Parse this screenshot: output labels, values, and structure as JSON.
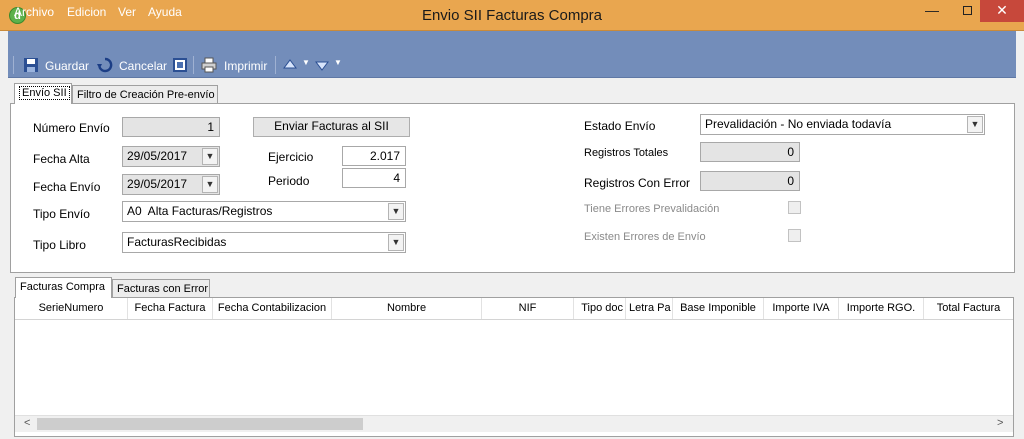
{
  "window": {
    "title": "Envio SII Facturas Compra",
    "app_icon": "d",
    "minimize": "—",
    "close": "✕"
  },
  "menu": [
    "Archivo",
    "Edicion",
    "Ver",
    "Ayuda"
  ],
  "toolbar": {
    "save_label": "Guardar",
    "cancel_label": "Cancelar",
    "print_label": "Imprimir"
  },
  "tabs_top": [
    "Envío SII",
    "Filtro de Creación Pre-envío"
  ],
  "form": {
    "numero_envio": {
      "label": "Número Envío",
      "value": "1"
    },
    "fecha_alta": {
      "label": "Fecha Alta",
      "value": "29/05/2017"
    },
    "fecha_envio": {
      "label": "Fecha Envío",
      "value": "29/05/2017"
    },
    "tipo_envio": {
      "label": "Tipo Envío",
      "value": "A0  Alta Facturas/Registros"
    },
    "tipo_libro": {
      "label": "Tipo Libro",
      "value": "FacturasRecibidas"
    },
    "enviar_button": "Enviar Facturas al SII",
    "ejercicio": {
      "label": "Ejercicio",
      "value": "2.017"
    },
    "periodo": {
      "label": "Periodo",
      "value": "4"
    },
    "estado_envio": {
      "label": "Estado Envío",
      "value": "Prevalidación - No enviada todavía"
    },
    "registros_totales": {
      "label": "Registros Totales",
      "value": "0"
    },
    "registros_error": {
      "label": "Registros Con Error",
      "value": "0"
    },
    "tiene_errores": {
      "label": "Tiene Errores Prevalidación"
    },
    "existen_errores": {
      "label": "Existen Errores de Envío"
    }
  },
  "tabs_bottom": [
    "Facturas Compra",
    "Facturas con Error"
  ],
  "grid": {
    "columns": [
      "SerieNumero",
      "Fecha Factura",
      "Fecha Contabilizacion",
      "Nombre",
      "NIF",
      "Tipo doc",
      "Letra Pa",
      "Base Imponible",
      "Importe IVA",
      "Importe RGO.",
      "Total Factura"
    ]
  },
  "colors": {
    "titlebar": "#e9a64f",
    "toolbar": "#738dba",
    "close": "#c7483b"
  }
}
